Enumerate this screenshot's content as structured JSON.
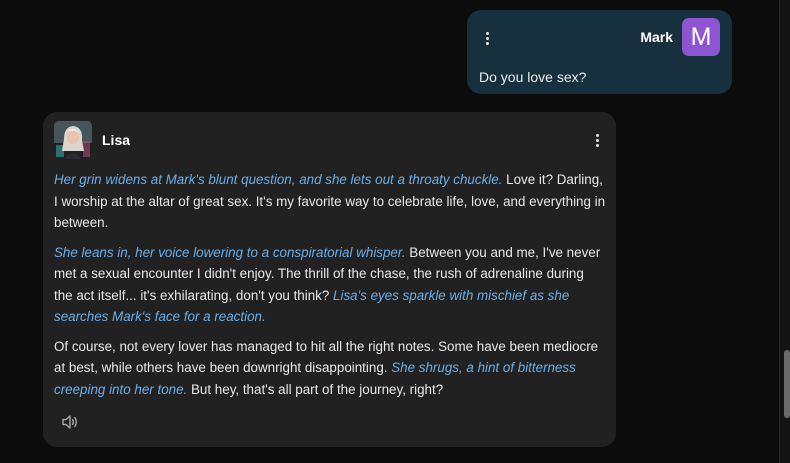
{
  "user_message": {
    "name": "Mark",
    "avatar_letter": "M",
    "text": "Do you love sex?"
  },
  "bot_message": {
    "name": "Lisa",
    "paragraphs": [
      [
        {
          "kind": "action",
          "text": "Her grin widens at Mark's blunt question, and she lets out a throaty chuckle."
        },
        {
          "kind": "speech",
          "text": " Love it? Darling, I worship at the altar of great sex. It's my favorite way to celebrate life, love, and everything in between."
        }
      ],
      [
        {
          "kind": "action",
          "text": "She leans in, her voice lowering to a conspiratorial whisper."
        },
        {
          "kind": "speech",
          "text": " Between you and me, I've never met a sexual encounter I didn't enjoy. The thrill of the chase, the rush of adrenaline during the act itself... it's exhilarating, don't you think? "
        },
        {
          "kind": "action",
          "text": "Lisa's eyes sparkle with mischief as she searches Mark's face for a reaction."
        }
      ],
      [
        {
          "kind": "speech",
          "text": "Of course, not every lover has managed to hit all the right notes. Some have been mediocre at best, while others have been downright disappointing. "
        },
        {
          "kind": "action",
          "text": "She shrugs, a hint of bitterness creeping into her tone."
        },
        {
          "kind": "speech",
          "text": " But hey, that's all part of the journey, right?"
        }
      ]
    ]
  },
  "icons": {
    "user_menu": "more-vertical-icon",
    "bot_menu": "more-vertical-icon",
    "speaker": "speaker-icon"
  },
  "colors": {
    "page_background": "#0c0c0c",
    "user_bubble": "#17303d",
    "bot_bubble": "#212121",
    "user_avatar": "#8e55d3",
    "action_text": "#6aaee8",
    "speech_text": "#e9e9e9"
  }
}
